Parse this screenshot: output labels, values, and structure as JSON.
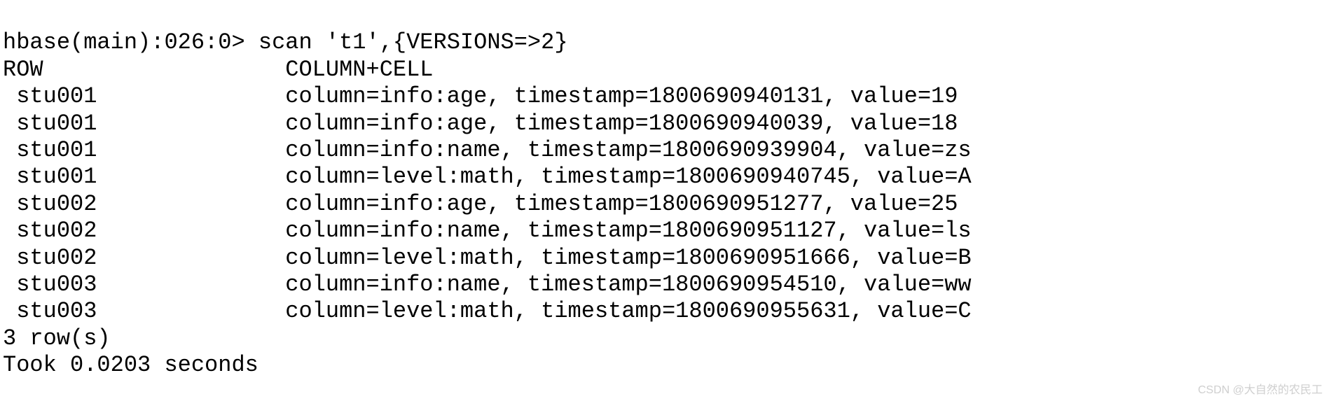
{
  "prompt": "hbase(main):026:0>",
  "command": "scan 't1',{VERSIONS=>2}",
  "header": {
    "row": "ROW",
    "cell": "COLUMN+CELL"
  },
  "results": [
    {
      "row": "stu001",
      "cell": "column=info:age, timestamp=1800690940131, value=19"
    },
    {
      "row": "stu001",
      "cell": "column=info:age, timestamp=1800690940039, value=18"
    },
    {
      "row": "stu001",
      "cell": "column=info:name, timestamp=1800690939904, value=zs"
    },
    {
      "row": "stu001",
      "cell": "column=level:math, timestamp=1800690940745, value=A"
    },
    {
      "row": "stu002",
      "cell": "column=info:age, timestamp=1800690951277, value=25"
    },
    {
      "row": "stu002",
      "cell": "column=info:name, timestamp=1800690951127, value=ls"
    },
    {
      "row": "stu002",
      "cell": "column=level:math, timestamp=1800690951666, value=B"
    },
    {
      "row": "stu003",
      "cell": "column=info:name, timestamp=1800690954510, value=ww"
    },
    {
      "row": "stu003",
      "cell": "column=level:math, timestamp=1800690955631, value=C"
    }
  ],
  "summary": {
    "row_count": "3 row(s)",
    "elapsed": "Took 0.0203 seconds"
  },
  "watermark": "CSDN @大自然的农民工"
}
